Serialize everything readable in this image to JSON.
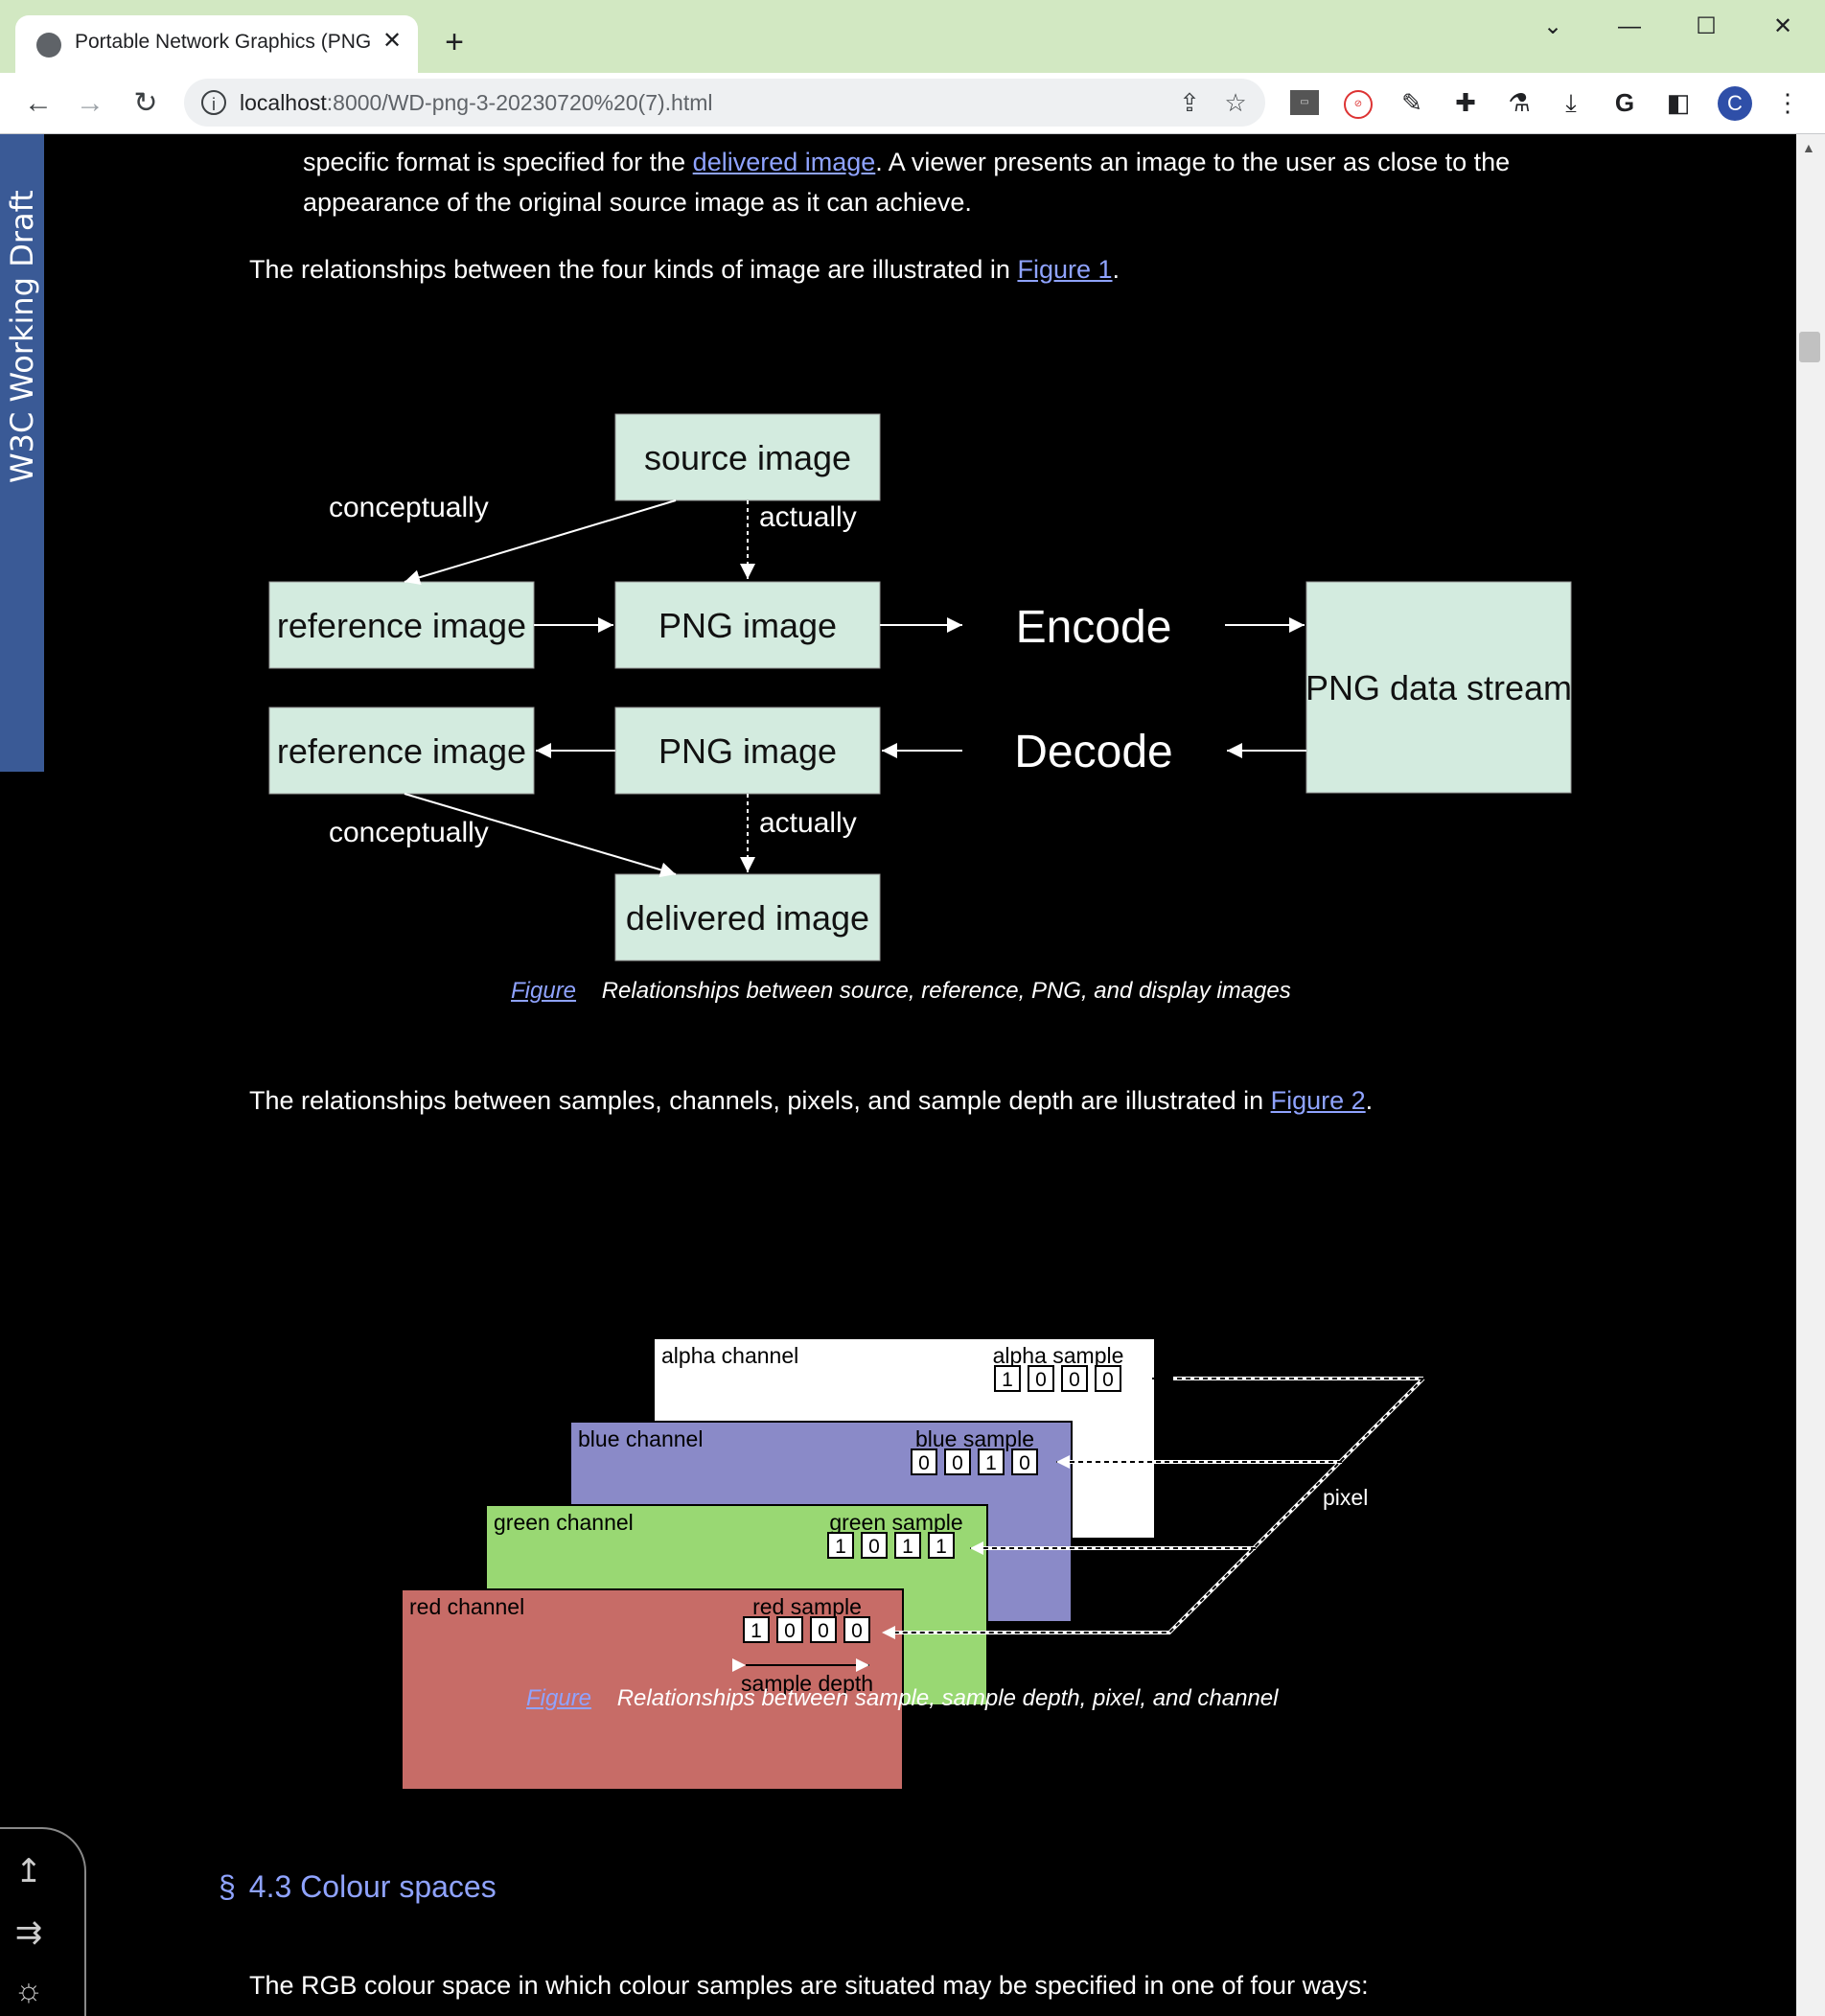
{
  "browser": {
    "tab_title": "Portable Network Graphics (PNG",
    "tab_close": "✕",
    "new_tab": "+",
    "url_host": "localhost",
    "url_path": ":8000/WD-png-3-20230720%20(7).html",
    "profile_initial": "C",
    "window_controls": [
      "⌄",
      "—",
      "☐",
      "✕"
    ],
    "extension_icons": [
      "video-ext-icon",
      "no-ads-icon",
      "eyedropper-icon",
      "puzzle-icon",
      "flask-icon",
      "download-icon",
      "google-icon",
      "sidepanel-icon"
    ]
  },
  "sidebar": {
    "label": "W3C Working Draft"
  },
  "content": {
    "para_line1_pre": "specific format is specified for the ",
    "para_line1_link": "delivered image",
    "para_line1_post": ". A viewer presents an image to the user as close to the",
    "para_line2": "appearance of the original source image as it can achieve.",
    "relationship1_pre": "The relationships between the four kinds of image are illustrated in ",
    "relationship1_link": "Figure 1",
    "relationship1_post": ".",
    "relationship2_pre": "The relationships between samples, channels, pixels, and sample depth are illustrated in ",
    "relationship2_link": "Figure 2",
    "relationship2_post": ".",
    "figure1_caption_link": "Figure",
    "figure1_caption": "Relationships between source, reference, PNG, and display images",
    "figure2_caption_link": "Figure",
    "figure2_caption": "Relationships between sample, sample depth, pixel, and channel",
    "heading_symbol": "§",
    "heading": "4.3 Colour spaces",
    "last_para": "The RGB colour space in which colour samples are situated may be specified in one of four ways:"
  },
  "figure1": {
    "source_image": "source image",
    "reference_image_top": "reference image",
    "png_image_top": "PNG image",
    "encode": "Encode",
    "png_data_stream": "PNG data stream",
    "reference_image_bottom": "reference image",
    "png_image_bottom": "PNG image",
    "decode": "Decode",
    "delivered_image": "delivered image",
    "conceptually_top": "conceptually",
    "actually_top": "actually",
    "conceptually_bottom": "conceptually",
    "actually_bottom": "actually",
    "box_color": "#d3ebdf"
  },
  "figure2": {
    "alpha_channel": "alpha channel",
    "alpha_sample": "alpha sample",
    "alpha_bits": [
      "1",
      "0",
      "0",
      "0"
    ],
    "blue_channel": "blue channel",
    "blue_sample": "blue sample",
    "blue_bits": [
      "0",
      "0",
      "1",
      "0"
    ],
    "green_channel": "green channel",
    "green_sample": "green sample",
    "green_bits": [
      "1",
      "0",
      "1",
      "1"
    ],
    "red_channel": "red channel",
    "red_sample": "red sample",
    "red_bits": [
      "1",
      "0",
      "0",
      "0"
    ],
    "sample_depth": "sample depth",
    "pixel": "pixel",
    "colors": {
      "alpha": "#ffffff",
      "blue": "#8a8ac8",
      "green": "#99d873",
      "red": "#c76c67"
    }
  },
  "corner_widget": {
    "icons": [
      "scroll-top-icon",
      "toc-toggle-icon",
      "theme-toggle-icon"
    ]
  }
}
